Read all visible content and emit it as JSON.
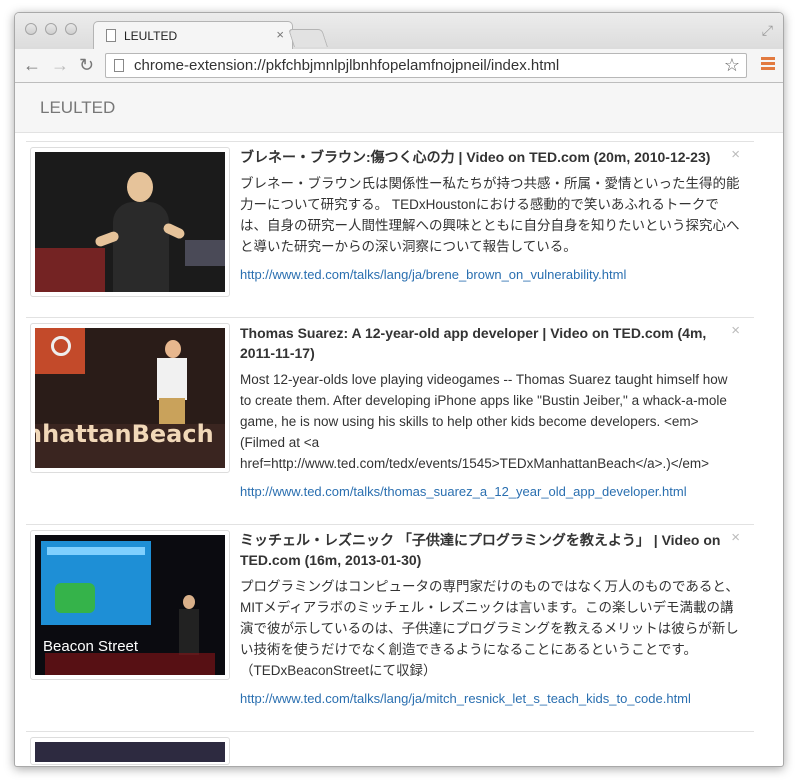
{
  "browser": {
    "tab_title": "LEULTED",
    "tab_close": "×",
    "url": "chrome-extension://pkfchbjmnlpjlbnhfopelamfnojpneil/index.html",
    "back": "←",
    "forward": "→",
    "reload": "↻",
    "star": "☆",
    "fullscreen": "⤢"
  },
  "app": {
    "title": "LEULTED"
  },
  "items": [
    {
      "title": "ブレネー・ブラウン:傷つく心の力 | Video on TED.com (20m, 2010-12-23)",
      "description": "ブレネー・ブラウン氏は関係性ー私たちが持つ共感・所属・愛情といった生得的能力ーについて研究する。 TEDxHoustonにおける感動的で笑いあふれるトークでは、自身の研究ー人間性理解への興味とともに自分自身を知りたいという探究心へと導いた研究ーからの深い洞察について報告している。",
      "link": "http://www.ted.com/talks/lang/ja/brene_brown_on_vulnerability.html",
      "close": "×"
    },
    {
      "title": "Thomas Suarez: A 12-year-old app developer | Video on TED.com (4m, 2011-11-17)",
      "description": "Most 12-year-olds love playing videogames -- Thomas Suarez taught himself how to create them. After developing iPhone apps like \"Bustin Jeiber,\" a whack-a-mole game, he is now using his skills to help other kids become developers. <em>(Filmed at <a href=http://www.ted.com/tedx/events/1545>TEDxManhattanBeach</a>.)</em>",
      "link": "http://www.ted.com/talks/thomas_suarez_a_12_year_old_app_developer.html",
      "close": "×",
      "thumb_text": "nhattanBeach"
    },
    {
      "title": "ミッチェル・レズニック 「子供達にプログラミングを教えよう」 | Video on TED.com (16m, 2013-01-30)",
      "description": "プログラミングはコンピュータの専門家だけのものではなく万人のものであると、MITメディアラボのミッチェル・レズニックは言います。この楽しいデモ満載の講演で彼が示しているのは、子供達にプログラミングを教えるメリットは彼らが新しい技術を使うだけでなく創造できるようになることにあるということです。（TEDxBeaconStreetにて収録）",
      "link": "http://www.ted.com/talks/lang/ja/mitch_resnick_let_s_teach_kids_to_code.html",
      "close": "×",
      "thumb_text": "Beacon Street"
    }
  ]
}
